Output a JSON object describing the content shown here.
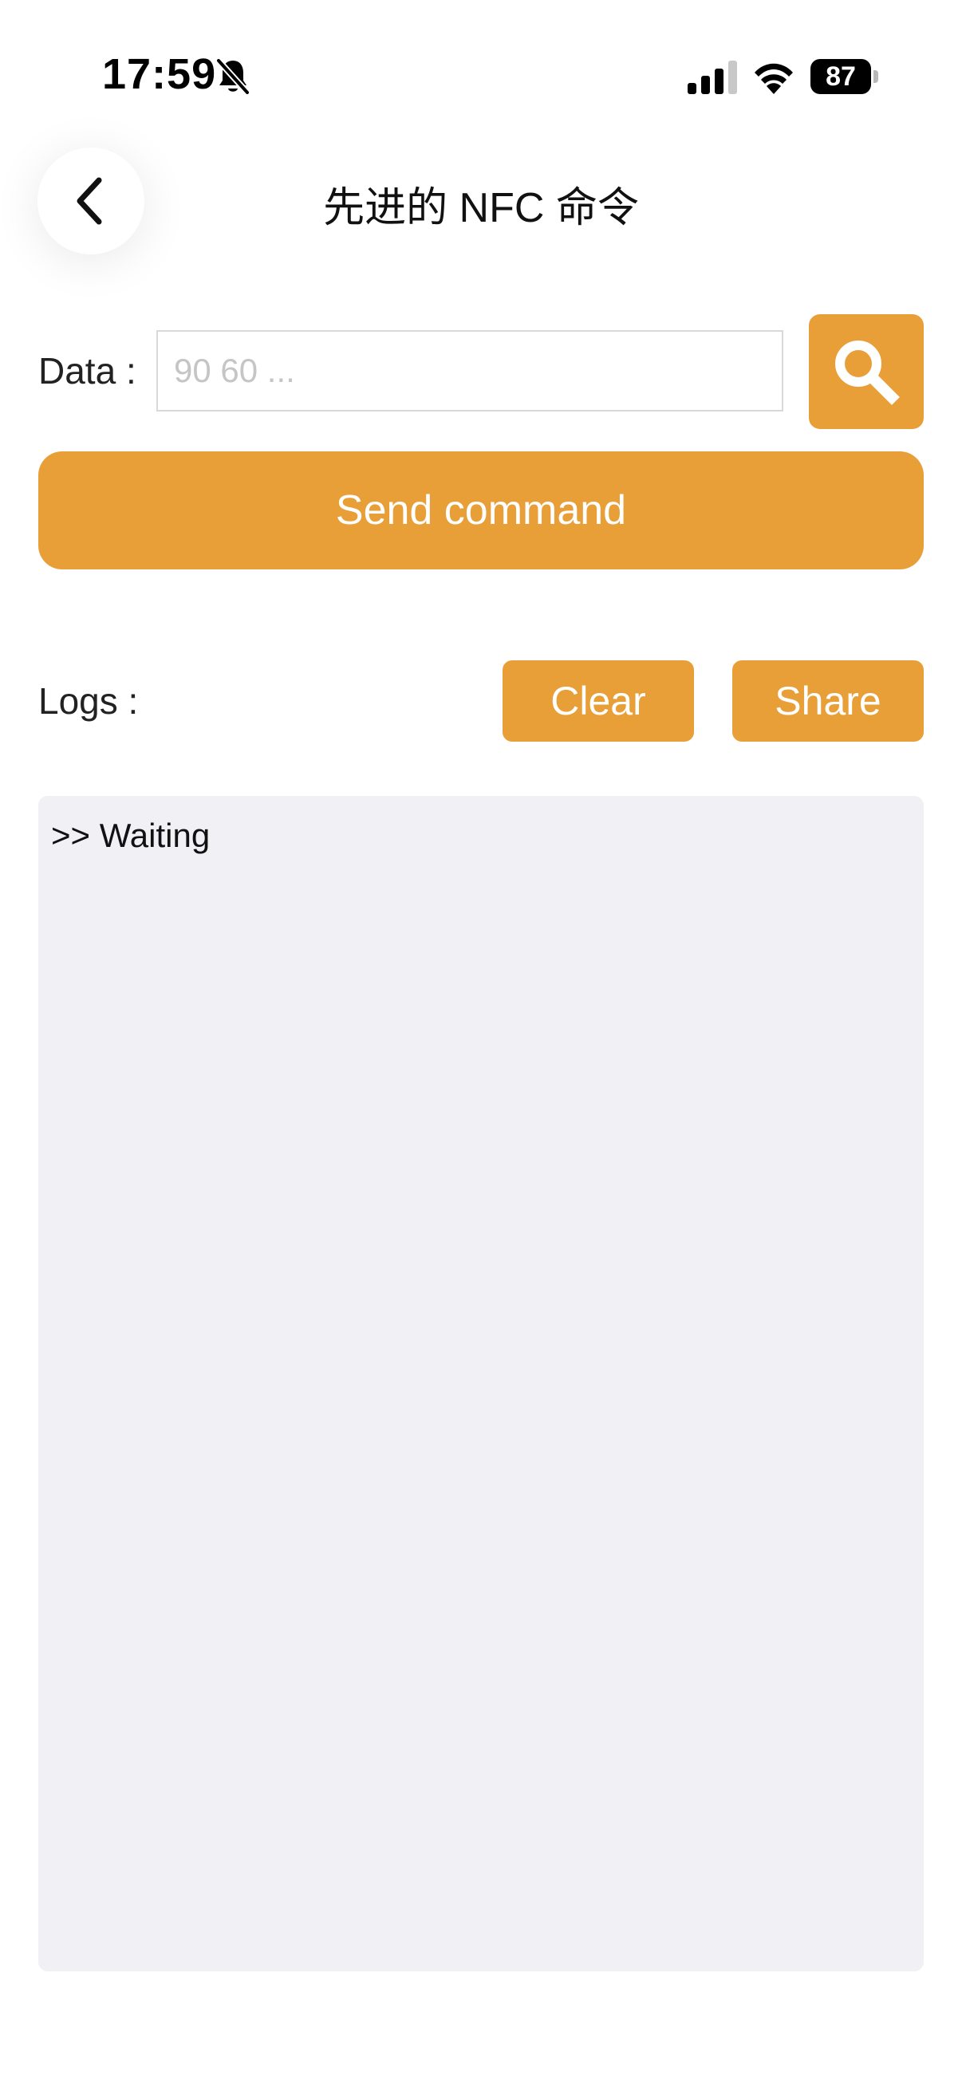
{
  "status_bar": {
    "time": "17:59",
    "battery_level": "87",
    "icons": [
      "bell-off-icon",
      "signal-icon",
      "wifi-icon",
      "battery-icon"
    ]
  },
  "nav": {
    "back_icon": "chevron-left-icon",
    "title": "先进的 NFC 命令"
  },
  "form": {
    "data_label": "Data :",
    "data_value": "",
    "data_placeholder": "90 60 ...",
    "scan_icon": "search-icon",
    "send_label": "Send command"
  },
  "logs": {
    "label": "Logs :",
    "clear_label": "Clear",
    "share_label": "Share",
    "lines": [
      ">> Waiting"
    ]
  },
  "colors": {
    "accent": "#e99f38",
    "log_background": "#f0f0f5",
    "placeholder": "#c5c5c5"
  }
}
